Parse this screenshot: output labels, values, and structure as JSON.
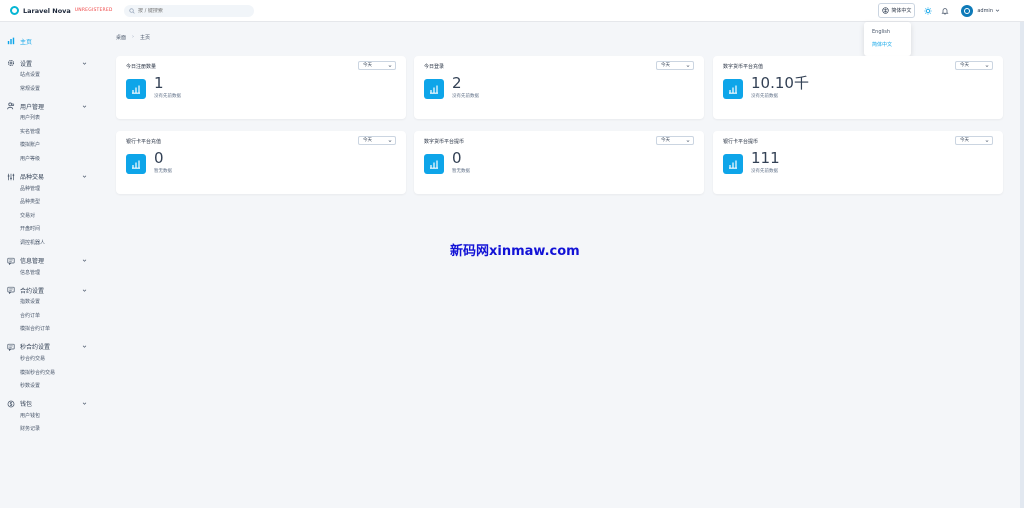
{
  "app": {
    "name": "Laravel Nova",
    "badge": "UNREGISTERED"
  },
  "search": {
    "placeholder": "按 / 键搜索"
  },
  "header": {
    "language": "简体中文",
    "user": "admin"
  },
  "lang_menu": {
    "items": [
      "English",
      "简体中文"
    ],
    "active": "简体中文"
  },
  "sidebar": {
    "main": "主页",
    "groups": [
      {
        "label": "设置",
        "items": [
          "站点设置",
          "常规设置"
        ]
      },
      {
        "label": "用户管理",
        "items": [
          "用户列表",
          "实名管理",
          "模拟账户",
          "用户等级"
        ]
      },
      {
        "label": "品种交易",
        "items": [
          "品种管理",
          "品种类型",
          "交易对",
          "开盘时间",
          "调控机器人"
        ]
      },
      {
        "label": "信息管理",
        "items": [
          "信息管理"
        ]
      },
      {
        "label": "合约设置",
        "items": [
          "指数设置",
          "合约订单",
          "模拟合约订单"
        ]
      },
      {
        "label": "秒合约设置",
        "items": [
          "秒合约交易",
          "模拟秒合约交易",
          "秒数设置"
        ]
      },
      {
        "label": "钱包",
        "items": [
          "用户钱包",
          "财务记录"
        ]
      }
    ]
  },
  "breadcrumb": {
    "root": "桌面",
    "current": "主页"
  },
  "cards": [
    {
      "title": "今日注册数量",
      "range": "今天",
      "value": "1",
      "sub": "没有先前数据"
    },
    {
      "title": "今日登录",
      "range": "今天",
      "value": "2",
      "sub": "没有先前数据"
    },
    {
      "title": "数字货币平台充值",
      "range": "今天",
      "value": "10.10千",
      "sub": "没有先前数据"
    },
    {
      "title": "银行卡平台充值",
      "range": "今天",
      "value": "0",
      "sub": "暂无数据"
    },
    {
      "title": "数字货币平台提币",
      "range": "今天",
      "value": "0",
      "sub": "暂无数据"
    },
    {
      "title": "银行卡平台提币",
      "range": "今天",
      "value": "111",
      "sub": "没有先前数据"
    }
  ],
  "watermark": "新码网xinmaw.com",
  "colors": {
    "accent": "#0ea5e9",
    "badge": "#ef4444",
    "watermark": "#1212d6"
  }
}
